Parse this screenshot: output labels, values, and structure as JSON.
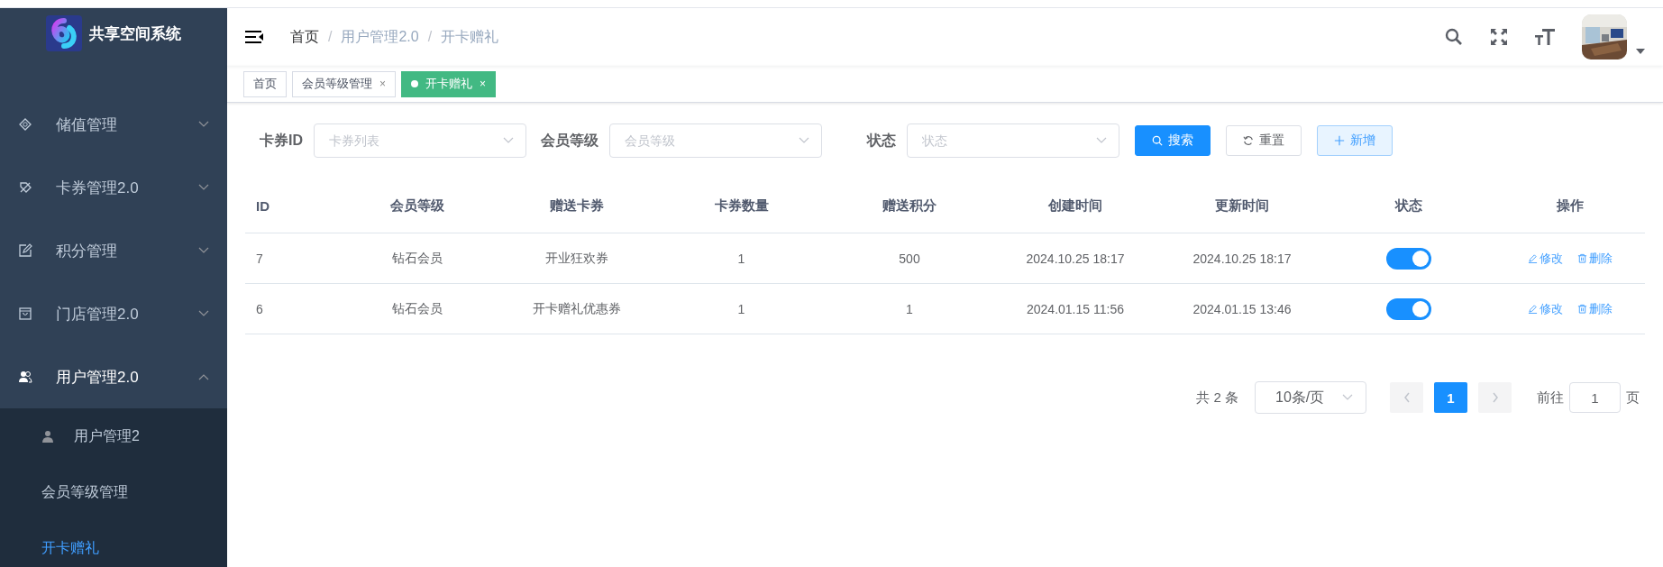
{
  "sidebar": {
    "logo_text": "共享空间系统",
    "menu": [
      {
        "label": "储值管理",
        "expanded": false
      },
      {
        "label": "卡券管理2.0",
        "expanded": false
      },
      {
        "label": "积分管理",
        "expanded": false
      },
      {
        "label": "门店管理2.0",
        "expanded": false
      },
      {
        "label": "用户管理2.0",
        "expanded": true,
        "children": [
          {
            "label": "用户管理2",
            "selected": false
          },
          {
            "label": "会员等级管理",
            "selected": false
          },
          {
            "label": "开卡赠礼",
            "selected": true
          }
        ]
      }
    ]
  },
  "header": {
    "breadcrumb": [
      {
        "label": "首页"
      },
      {
        "separator": "/",
        "label": "用户管理2.0"
      },
      {
        "separator": "/",
        "label": "开卡赠礼"
      }
    ]
  },
  "tabs": [
    {
      "label": "首页",
      "selected": false
    },
    {
      "label": "会员等级管理",
      "close": "×",
      "selected": false
    },
    {
      "label": "开卡赠礼",
      "close": "×",
      "selected": true
    }
  ],
  "filters": [
    {
      "label": "卡券ID",
      "placeholder": "卡券列表"
    },
    {
      "label": "会员等级",
      "placeholder": "会员等级"
    },
    {
      "label": "状态",
      "placeholder": "状态"
    }
  ],
  "buttons": [
    {
      "label": "搜索",
      "kind": "primary"
    },
    {
      "label": "重置",
      "kind": "default"
    },
    {
      "label": "新增",
      "kind": "plain"
    }
  ],
  "table": {
    "columns": [
      "ID",
      "会员等级",
      "赠送卡券",
      "卡券数量",
      "赠送积分",
      "创建时间",
      "更新时间",
      "状态",
      "操作"
    ],
    "rows": [
      {
        "cells": [
          "7",
          "钻石会员",
          "开业狂欢券",
          "1",
          "500",
          "2024.10.25 18:17",
          "2024.10.25 18:17"
        ],
        "on": true,
        "actions": [
          "修改",
          "删除"
        ]
      },
      {
        "cells": [
          "6",
          "钻石会员",
          "开卡赠礼优惠券",
          "1",
          "1",
          "2024.01.15 11:56",
          "2024.01.15 13:46"
        ],
        "on": true,
        "actions": [
          "修改",
          "删除"
        ]
      }
    ]
  },
  "pagination": {
    "total": "共 2 条",
    "page_size": "10条/页",
    "pages": [
      {
        "label": "1",
        "selected": true
      }
    ],
    "goto_label": "前往",
    "goto_value": "1",
    "goto_suffix": "页"
  }
}
